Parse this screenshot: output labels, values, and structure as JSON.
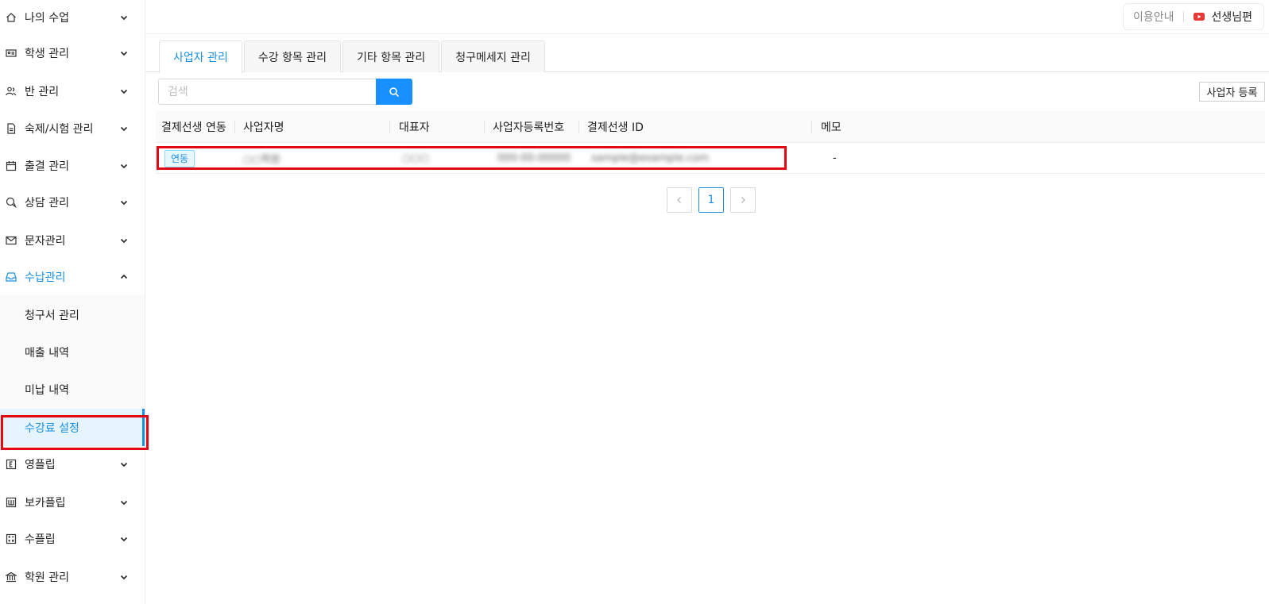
{
  "sidebar": {
    "items": [
      {
        "label": "나의 수업",
        "icon": "home-icon",
        "expanded": false
      },
      {
        "label": "학생 관리",
        "icon": "id-card-icon",
        "expanded": false
      },
      {
        "label": "반 관리",
        "icon": "group-icon",
        "expanded": false
      },
      {
        "label": "숙제/시험 관리",
        "icon": "document-icon",
        "expanded": false
      },
      {
        "label": "출결 관리",
        "icon": "calendar-icon",
        "expanded": false
      },
      {
        "label": "상담 관리",
        "icon": "chat-icon",
        "expanded": false
      },
      {
        "label": "문자관리",
        "icon": "mail-icon",
        "expanded": false
      },
      {
        "label": "수납관리",
        "icon": "inbox-icon",
        "expanded": true
      },
      {
        "label": "영플립",
        "icon": "e-box-icon",
        "expanded": false
      },
      {
        "label": "보카플립",
        "icon": "w-box-icon",
        "expanded": false
      },
      {
        "label": "수플립",
        "icon": "calculator-icon",
        "expanded": false
      },
      {
        "label": "학원 관리",
        "icon": "bank-icon",
        "expanded": false
      }
    ],
    "submenu": [
      {
        "label": "청구서 관리"
      },
      {
        "label": "매출 내역"
      },
      {
        "label": "미납 내역"
      },
      {
        "label": "수강료 설정"
      }
    ],
    "active_submenu": "수강료 설정"
  },
  "topbar": {
    "guide_label": "이용안내",
    "teacher_label": "선생님편"
  },
  "tabs": [
    {
      "label": "사업자 관리",
      "active": true
    },
    {
      "label": "수강 항목 관리",
      "active": false
    },
    {
      "label": "기타 항목 관리",
      "active": false
    },
    {
      "label": "청구메세지 관리",
      "active": false
    }
  ],
  "search": {
    "placeholder": "검색",
    "value": ""
  },
  "register_button_label": "사업자 등록",
  "table": {
    "columns": [
      "결제선생 연동",
      "사업자명",
      "대표자",
      "사업자등록번호",
      "결제선생 ID",
      "메모"
    ],
    "rows": [
      {
        "link_status": "연동",
        "business_name": "○○학원",
        "representative": "○○○",
        "business_number": "000-00-00000",
        "payment_id": "sample@example.com",
        "memo": "-"
      }
    ]
  },
  "pagination": {
    "current_page": "1"
  },
  "colors": {
    "accent": "#1a8fe3",
    "search_button": "#1890ff",
    "highlight": "#e10a14",
    "youtube": "#e53935"
  }
}
